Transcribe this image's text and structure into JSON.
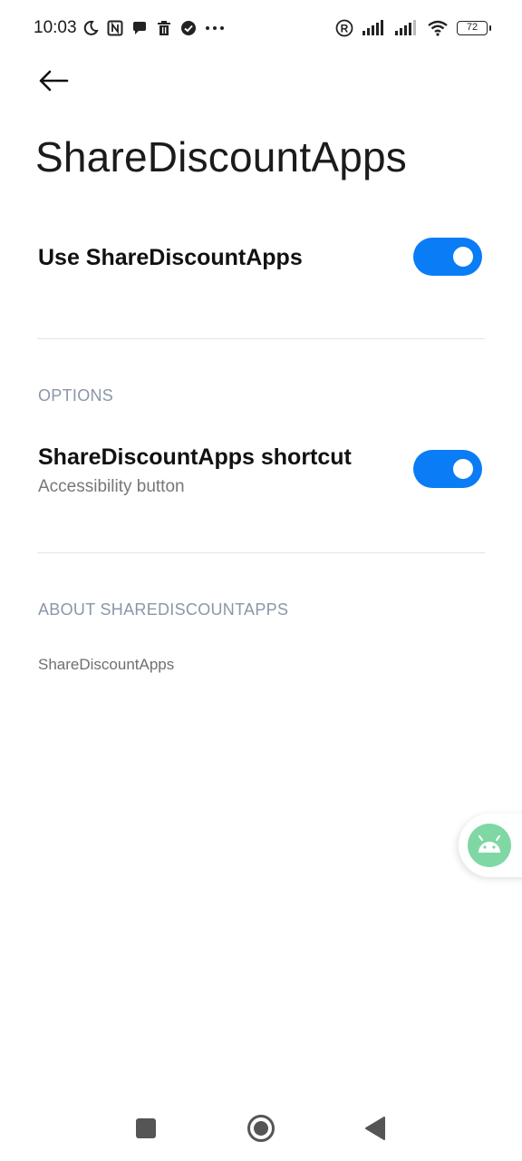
{
  "status_bar": {
    "time": "10:03",
    "battery_level": "72",
    "left_icons": [
      "moon-icon",
      "nfc-icon",
      "chat-bubble-icon",
      "trash-icon",
      "check-circle-icon",
      "more-dots-icon"
    ],
    "right_icons": [
      "registered-icon",
      "signal-icon",
      "signal-icon",
      "wifi-icon",
      "battery-icon"
    ]
  },
  "header": {
    "title": "ShareDiscountApps"
  },
  "main_toggle": {
    "label": "Use ShareDiscountApps",
    "checked": true
  },
  "options_section": {
    "header": "OPTIONS",
    "shortcut": {
      "title": "ShareDiscountApps shortcut",
      "subtitle": "Accessibility button",
      "checked": true
    }
  },
  "about_section": {
    "header": "ABOUT SHAREDISCOUNTAPPS",
    "text": "ShareDiscountApps"
  },
  "floating_button": {
    "icon": "android-icon"
  },
  "nav_bar": {
    "buttons": [
      "recents-square-icon",
      "home-circle-icon",
      "back-triangle-icon"
    ]
  },
  "colors": {
    "accent": "#0a7cf5",
    "section_header": "#8a96a8",
    "floating": "#7fd8a4"
  }
}
